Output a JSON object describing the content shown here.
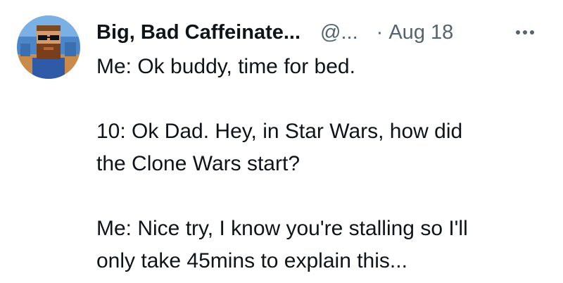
{
  "tweet": {
    "author": {
      "display_name": "Big, Bad Caffeinate...",
      "handle": "@...",
      "avatar_icon": "bearded-man-sunglasses-avatar-icon"
    },
    "separator": "·",
    "date": "Aug 18",
    "more_icon": "more-options-icon",
    "paragraphs": [
      {
        "lines": [
          "Me: Ok buddy, time for bed."
        ]
      },
      {
        "lines": [
          "10: Ok Dad. Hey, in Star Wars, how did",
          "the Clone Wars start?"
        ]
      },
      {
        "lines": [
          "Me: Nice try, I know you're stalling so I'll",
          "only take 45mins to explain this..."
        ]
      }
    ]
  },
  "colors": {
    "text_primary": "#0f1419",
    "text_secondary": "#536471",
    "background": "#ffffff"
  }
}
